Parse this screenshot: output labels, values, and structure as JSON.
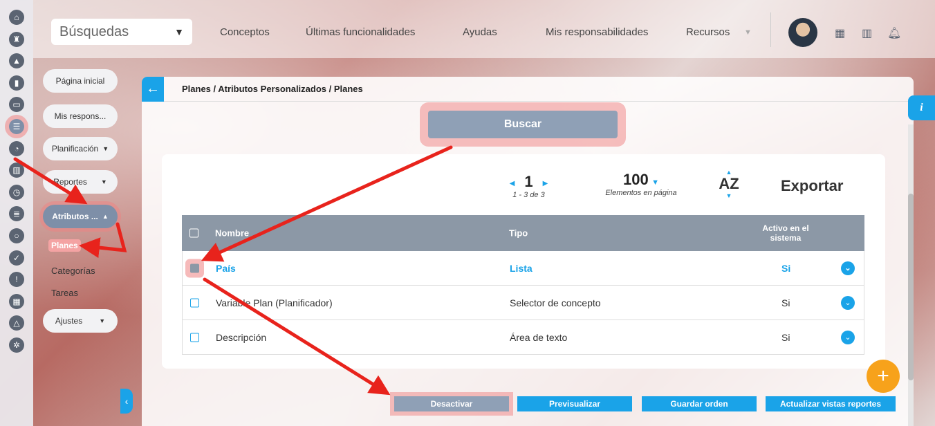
{
  "topbar": {
    "search_label": "Búsquedas",
    "nav": [
      "Conceptos",
      "Últimas funcionalidades",
      "Ayudas",
      "Mis responsabilidades",
      "Recursos"
    ]
  },
  "sidebar": {
    "items": [
      {
        "label": "Página inicial"
      },
      {
        "label": "Mis respons..."
      },
      {
        "label": "Planificación"
      },
      {
        "label": "Reportes"
      },
      {
        "label": "Atributos ..."
      }
    ],
    "sub_items": [
      "Planes",
      "Categorías",
      "Tareas"
    ],
    "settings": "Ajustes"
  },
  "breadcrumb": "Planes / Atributos Personalizados / Planes",
  "search_button": "Buscar",
  "pager": {
    "page": "1",
    "range": "1 - 3 de 3"
  },
  "per_page": {
    "value": "100",
    "label": "Elementos en página"
  },
  "sort_label": "AZ",
  "export_label": "Exportar",
  "table": {
    "headers": {
      "name": "Nombre",
      "type": "Tipo",
      "active": "Activo en el sistema"
    },
    "rows": [
      {
        "name": "País",
        "type": "Lista",
        "active": "Si"
      },
      {
        "name": "Variable Plan (Planificador)",
        "type": "Selector de concepto",
        "active": "Si"
      },
      {
        "name": "Descripción",
        "type": "Área de texto",
        "active": "Si"
      }
    ]
  },
  "actions": {
    "deactivate": "Desactivar",
    "preview": "Previsualizar",
    "save_order": "Guardar orden",
    "update_views": "Actualizar vistas reportes"
  },
  "info_label": "i",
  "colors": {
    "accent": "#1aa3e8",
    "muted": "#8fa0b6",
    "highlight": "#f08c8c",
    "fab": "#f7a21b",
    "arrow": "#e8231c"
  }
}
